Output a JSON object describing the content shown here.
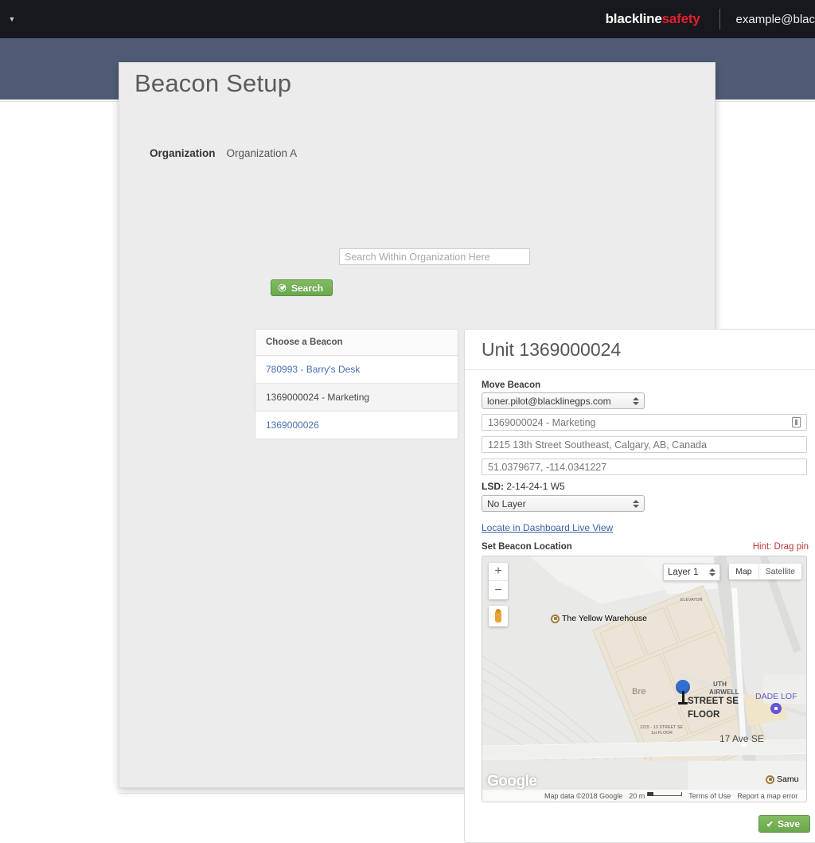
{
  "topbar": {
    "menu_caret_icon": "caret-down-icon",
    "brand_first": "blackline",
    "brand_second": "safety",
    "user_email": "example@blac"
  },
  "modal": {
    "page_title": "Beacon Setup",
    "organization_label": "Organization",
    "organization_value": "Organization A",
    "search_placeholder": "Search Within Organization Here",
    "search_value": "",
    "search_button_label": "Search",
    "search_button_icon": "refresh-circle-icon"
  },
  "beacon_list": {
    "header": "Choose a Beacon",
    "items": [
      {
        "label": "780993 - Barry's Desk",
        "selected": false
      },
      {
        "label": "1369000024 - Marketing",
        "selected": true
      },
      {
        "label": "1369000026",
        "selected": false
      }
    ]
  },
  "detail": {
    "title": "Unit 1369000024",
    "move_beacon_label": "Move Beacon",
    "move_beacon_value": "loner.pilot@blacklinegps.com",
    "name_value": "1369000024 - Marketing",
    "name_icon": "tag-scan-icon",
    "address_value": "1215 13th Street Southeast, Calgary, AB, Canada",
    "coords_value": "51.0379677, -114.0341227",
    "lsd_label": "LSD:",
    "lsd_value": "2-14-24-1 W5",
    "layer_select_value": "No Layer",
    "live_view_link": "Locate in Dashboard Live View",
    "set_location_label": "Set Beacon Location",
    "hint_text": "Hint: Drag pin",
    "save_button_label": "Save",
    "save_button_icon": "check-icon"
  },
  "map": {
    "zoom_in_label": "+",
    "zoom_out_label": "−",
    "pegman_icon": "street-view-pegman-icon",
    "layer_value": "Layer 1",
    "maptype_map": "Map",
    "maptype_satellite": "Satellite",
    "poi_warehouse": "The Yellow Warehouse",
    "poi_dade": "DADE LOF",
    "poi_samu": "Samu",
    "street_17ave": "17 Ave SE",
    "floor_street": "STREET SE",
    "floor_label": "FLOOR",
    "floor_caption_1": "1215 - 13 STREET SE",
    "floor_caption_2": "1st FLOOR",
    "label_elevator": "ELEVATOR",
    "label_airwell": "AIRWELL",
    "label_uth": "UTH",
    "label_bre": "Bre",
    "google_logo": "Google",
    "attribution": "Map data ©2018 Google",
    "scale_label": "20 m",
    "terms_label": "Terms of Use",
    "report_label": "Report a map error"
  },
  "colors": {
    "topbar_bg": "#16181e",
    "slate_band": "#505c75",
    "brand_red": "#e2202c",
    "green_button": "#6aa84f",
    "link_blue": "#3a63a8",
    "hint_red": "#b9393e",
    "pin_blue": "#2f6fd0"
  }
}
